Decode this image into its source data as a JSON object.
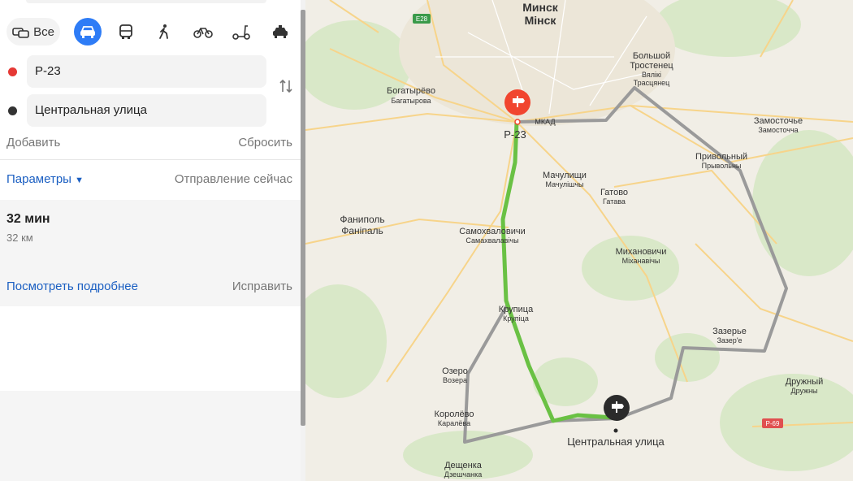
{
  "modes": {
    "all_label": "Все",
    "items": [
      {
        "name": "car"
      },
      {
        "name": "bus"
      },
      {
        "name": "walk"
      },
      {
        "name": "bike"
      },
      {
        "name": "scooter"
      },
      {
        "name": "taxi"
      }
    ]
  },
  "route": {
    "from": "Р-23",
    "to": "Центральная улица",
    "from_color": "#e53935",
    "to_color": "#333333",
    "add_label": "Добавить",
    "reset_label": "Сбросить",
    "params_label": "Параметры",
    "departure_label": "Отправление сейчас"
  },
  "summary": {
    "time": "32 мин",
    "distance": "32 км",
    "details_label": "Посмотреть подробнее",
    "fix_label": "Исправить"
  },
  "map": {
    "route_color": "#6ac144",
    "alt_route_color": "#9a9a9a",
    "start_marker_color": "#f1452f",
    "end_marker_color": "#2b2b2b",
    "start_label": "Р-23",
    "end_label": "Центральная улица",
    "labels": {
      "minsk_ru": "Минск",
      "minsk_be": "Мінск",
      "bogatyrevo_ru": "Богатырёво",
      "bogatyrevo_be": "Багатырова",
      "mkad": "МКАД",
      "bolshoy_trostenets_1": "Большой",
      "bolshoy_trostenets_2": "Тростенец",
      "bolshoy_trostenets_be1": "Вялікі",
      "bolshoy_trostenets_be2": "Трасцянец",
      "zamostochye_ru": "Замосточье",
      "zamostochye_be": "Замосточча",
      "privolny_ru": "Привольный",
      "privolny_be": "Прывольны",
      "machulishchi_ru": "Мачулищи",
      "machulishchi_be": "Мачулішчы",
      "gatovo_ru": "Гатово",
      "gatovo_be": "Гатава",
      "fanipol_ru": "Фаниполь",
      "fanipol_be": "Фаніпаль",
      "samokhvalovichi_ru": "Самохваловичи",
      "samokhvalovichi_be": "Самахвалавічы",
      "mikhanovichi_ru": "Михановичи",
      "mikhanovichi_be": "Міханавічы",
      "krupitsa_ru": "Крупица",
      "krupitsa_be": "Крупіца",
      "zazerye_ru": "Зазерье",
      "zazerye_be": "Зазер'е",
      "ozero_ru": "Озеро",
      "ozero_be": "Возера",
      "druzhny_ru": "Дружный",
      "druzhny_be": "Дружны",
      "korolevo_ru": "Королёво",
      "korolevo_be": "Каралёва",
      "deshchenka_ru": "Дещенка",
      "deshchenka_be": "Дзешчанка",
      "e28": "E28",
      "r69": "Р-69"
    }
  }
}
